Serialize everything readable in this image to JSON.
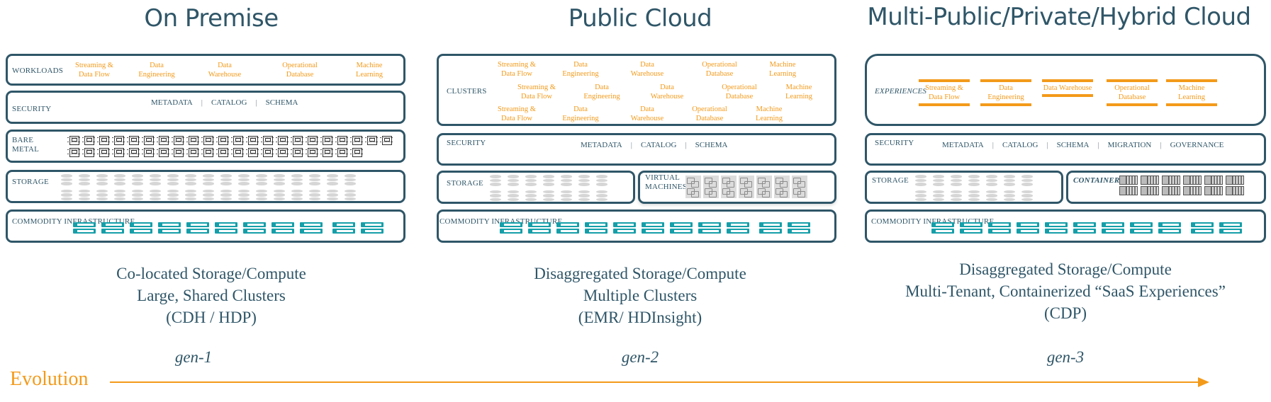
{
  "colors": {
    "primary": "#2f5668",
    "accent": "#f39a1a",
    "server": "#159fa9"
  },
  "evolution_label": "Evolution",
  "columns": [
    {
      "title": "On Premise",
      "workloads_label": "WORKLOADS",
      "workloads": [
        "Streaming & Data Flow",
        "Data Engineering",
        "Data Warehouse",
        "Operational Database",
        "Machine Learning"
      ],
      "security_label": "SECURITY",
      "security_items": [
        "METADATA",
        "CATALOG",
        "SCHEMA"
      ],
      "bare_metal_label": "BARE METAL",
      "storage_label": "STORAGE",
      "infra_label": "COMMODITY INFRASTRUCTURE",
      "description": [
        "Co-located Storage/Compute",
        "Large, Shared Clusters",
        "(CDH / HDP)"
      ],
      "generation": "gen-1"
    },
    {
      "title": "Public Cloud",
      "clusters_label": "CLUSTERS",
      "clusters": [
        [
          "Streaming & Data Flow",
          "Data Engineering",
          "Data Warehouse",
          "Operational Database",
          "Machine Learning"
        ],
        [
          "Streaming & Data Flow",
          "Data Engineering",
          "Data Warehouse",
          "Operational Database",
          "Machine Learning"
        ],
        [
          "Streaming & Data Flow",
          "Data Engineering",
          "Data Warehouse",
          "Operational Database",
          "Machine Learning"
        ]
      ],
      "security_label": "SECURITY",
      "security_items": [
        "METADATA",
        "CATALOG",
        "SCHEMA"
      ],
      "storage_label": "STORAGE",
      "vm_label": "VIRTUAL MACHINES",
      "infra_label": "COMMODITY INFRASTRUCTURE",
      "description": [
        "Disaggregated Storage/Compute",
        "Multiple Clusters",
        "(EMR/ HDInsight)"
      ],
      "generation": "gen-2"
    },
    {
      "title": "Multi-Public/Private/Hybrid Cloud",
      "experiences_label": "EXPERIENCES",
      "experiences": [
        "Streaming & Data Flow",
        "Data Engineering",
        "Data Warehouse",
        "Operational Database",
        "Machine Learning"
      ],
      "security_label": "SECURITY",
      "security_items": [
        "METADATA",
        "CATALOG",
        "SCHEMA",
        "MIGRATION",
        "GOVERNANCE"
      ],
      "storage_label": "STORAGE",
      "containers_label": "CONTAINERS",
      "infra_label": "COMMODITY INFRASTRUCTURE",
      "description": [
        "Disaggregated Storage/Compute",
        "Multi-Tenant, Containerized “SaaS Experiences”",
        "(CDP)"
      ],
      "generation": "gen-3"
    }
  ]
}
